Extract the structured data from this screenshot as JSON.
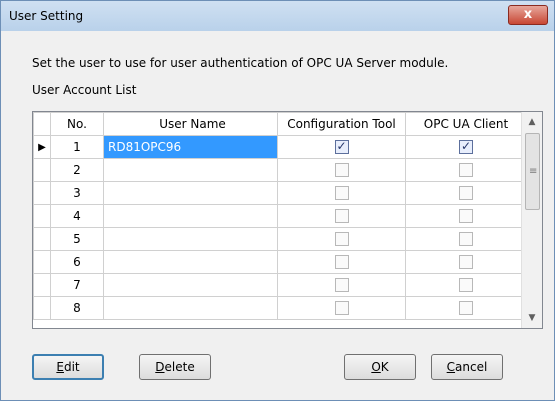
{
  "window": {
    "title": "User Setting",
    "close_label": "x"
  },
  "intro_text": "Set the user to use for user authentication of OPC UA Server module.",
  "section_label": "User Account List",
  "columns": [
    "No.",
    "User Name",
    "Configuration Tool",
    "OPC UA Client"
  ],
  "rows": [
    {
      "no": "1",
      "user": "RD81OPC96",
      "config": true,
      "client": true
    },
    {
      "no": "2",
      "user": "",
      "config": false,
      "client": false
    },
    {
      "no": "3",
      "user": "",
      "config": false,
      "client": false
    },
    {
      "no": "4",
      "user": "",
      "config": false,
      "client": false
    },
    {
      "no": "5",
      "user": "",
      "config": false,
      "client": false
    },
    {
      "no": "6",
      "user": "",
      "config": false,
      "client": false
    },
    {
      "no": "7",
      "user": "",
      "config": false,
      "client": false
    },
    {
      "no": "8",
      "user": "",
      "config": false,
      "client": false
    }
  ],
  "current_row_marker": "▶",
  "buttons": {
    "edit": {
      "mnemonic": "E",
      "rest": "dit"
    },
    "delete": {
      "mnemonic": "D",
      "rest": "elete"
    },
    "ok": {
      "mnemonic": "O",
      "rest": "K"
    },
    "cancel": {
      "mnemonic": "C",
      "rest": "ancel"
    }
  }
}
